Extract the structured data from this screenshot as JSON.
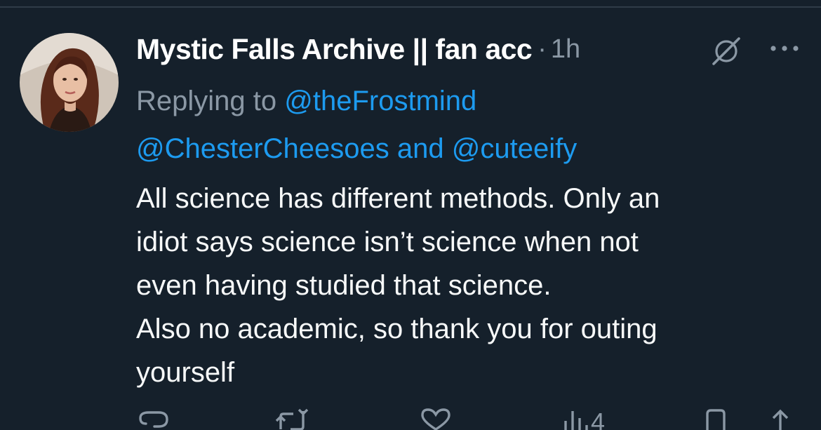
{
  "tweet": {
    "display_name": "Mystic Falls Archive || fan acc",
    "separator": "·",
    "time": "1h",
    "replying_label": "Replying to",
    "mentions": [
      "@theFrostmind",
      "@ChesterCheesoes",
      "@cuteeify"
    ],
    "mention_joiner": "and",
    "body_lines": [
      "All science has different methods. Only an",
      "idiot says science isn’t science when not",
      "even having studied that science.",
      "Also no academic, so thank you for outing",
      "yourself"
    ]
  },
  "actions": {
    "reply_icon": "reply-icon",
    "retweet_icon": "retweet-icon",
    "like_icon": "heart-icon",
    "views_icon": "views-icon",
    "views_count": "4",
    "bookmark_icon": "bookmark-icon",
    "share_icon": "share-icon"
  },
  "header_icons": [
    "grok-icon",
    "more-icon"
  ],
  "colors": {
    "background": "#15202b",
    "primary_text": "#f7f9f9",
    "secondary_text": "#8b98a5",
    "link": "#1d9bf0",
    "divider": "#2f3c48"
  }
}
